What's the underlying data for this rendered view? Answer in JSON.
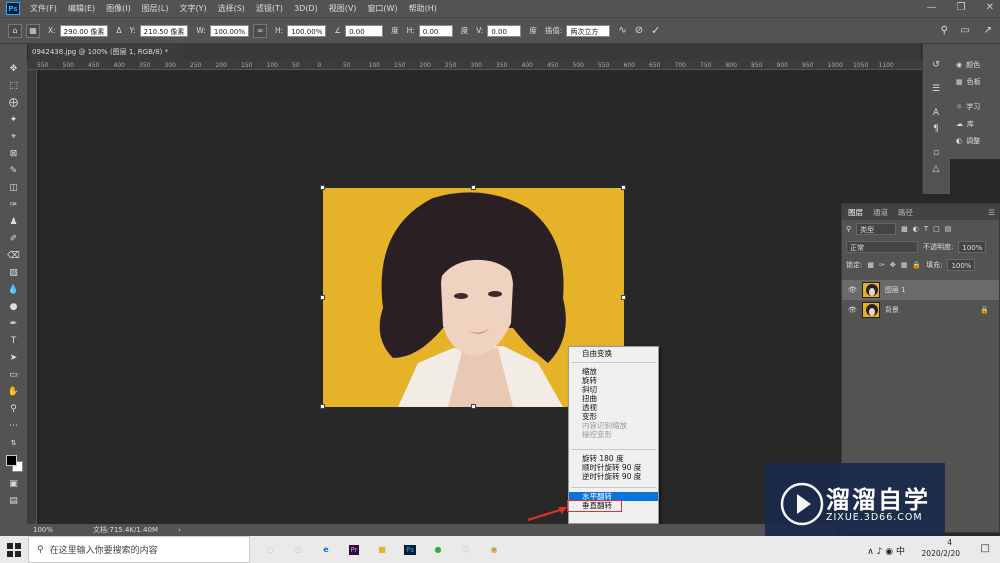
{
  "app": {
    "logo": "Ps"
  },
  "menu": [
    "文件(F)",
    "编辑(E)",
    "图像(I)",
    "图层(L)",
    "文字(Y)",
    "选择(S)",
    "滤镜(T)",
    "3D(D)",
    "视图(V)",
    "窗口(W)",
    "帮助(H)"
  ],
  "options": {
    "x_label": "X:",
    "x_value": "290.00 像素",
    "y_label": "Y:",
    "y_value": "210.50 像素",
    "w_label": "W:",
    "w_value": "100.00%",
    "h_label": "H:",
    "h_value": "100.00%",
    "angle_value": "0.00",
    "angle_unit": "度",
    "hskew_label": "H:",
    "hskew_value": "0.00",
    "hskew_unit": "度",
    "vskew_label": "V:",
    "vskew_value": "0.00",
    "vskew_unit": "度",
    "interp_label": "插值:",
    "interp_value": "两次立方"
  },
  "document": {
    "tab_title": "0942438.jpg @ 100% (图层 1, RGB/8) *",
    "zoom": "100%",
    "doc_info": "文档:715.4K/1.40M"
  },
  "ruler_ticks": [
    "550",
    "500",
    "450",
    "400",
    "350",
    "300",
    "250",
    "200",
    "150",
    "100",
    "50",
    "0",
    "50",
    "100",
    "150",
    "200",
    "250",
    "300",
    "350",
    "400",
    "450",
    "500",
    "550",
    "600",
    "650",
    "700",
    "750",
    "800",
    "850",
    "900",
    "950",
    "1000",
    "1050",
    "1100"
  ],
  "context_menu": {
    "group1": [
      "自由变换"
    ],
    "group2": [
      "缩放",
      "旋转",
      "斜切",
      "扭曲",
      "透视",
      "变形"
    ],
    "group2_disabled": [
      "内容识别缩放",
      "操控变形"
    ],
    "group3": [
      "旋转 180 度",
      "顺时针旋转 90 度",
      "逆时针旋转 90 度"
    ],
    "group4_highlight": "水平翻转",
    "group4_rest": "垂直翻转"
  },
  "right_panel": {
    "items": [
      "颜色",
      "色板",
      "学习",
      "库",
      "调整"
    ]
  },
  "layers_panel": {
    "tabs": [
      "图层",
      "通道",
      "路径"
    ],
    "filter": "类型",
    "blend": "正常",
    "opacity_label": "不透明度:",
    "opacity": "100%",
    "lock_label": "锁定:",
    "fill_label": "填充:",
    "fill": "100%",
    "layers": [
      "图层 1",
      "背景"
    ]
  },
  "taskbar": {
    "search_placeholder": "在这里输入你要搜索的内容",
    "time": "4",
    "date": "2020/2/20"
  },
  "watermark": {
    "brand": "溜溜自学",
    "url": "ZIXUE.3D66.COM"
  },
  "colors": {
    "accent": "#0a74d8",
    "photo_bg": "#e6b228",
    "ps_blue": "#31a8ff"
  }
}
